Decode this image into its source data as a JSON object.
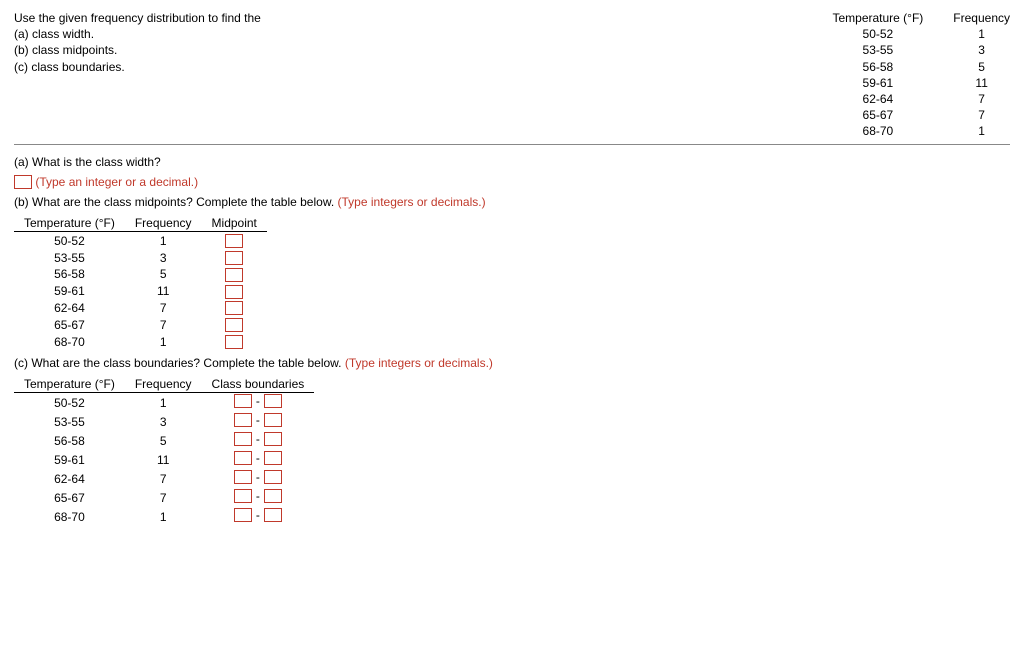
{
  "prompt": {
    "intro": "Use the given frequency distribution to find the",
    "a": "(a) class width.",
    "b": "(b) class midpoints.",
    "c": "(c) class boundaries."
  },
  "refTable": {
    "headerTemp": "Temperature (°F)",
    "headerFreq": "Frequency",
    "rows": [
      {
        "temp": "50-52",
        "freq": "1"
      },
      {
        "temp": "53-55",
        "freq": "3"
      },
      {
        "temp": "56-58",
        "freq": "5"
      },
      {
        "temp": "59-61",
        "freq": "11"
      },
      {
        "temp": "62-64",
        "freq": "7"
      },
      {
        "temp": "65-67",
        "freq": "7"
      },
      {
        "temp": "68-70",
        "freq": "1"
      }
    ]
  },
  "qA": {
    "question": "(a) What is the class width?",
    "instr": "(Type an integer or a decimal.)"
  },
  "qB": {
    "question": "(b) What are the class midpoints? Complete the table below.",
    "instr": "(Type integers or decimals.)",
    "headers": {
      "temp": "Temperature (°F)",
      "freq": "Frequency",
      "mid": "Midpoint"
    }
  },
  "qC": {
    "question": "(c) What are the class boundaries? Complete the table below.",
    "instr": "(Type integers or decimals.)",
    "headers": {
      "temp": "Temperature (°F)",
      "freq": "Frequency",
      "bnd": "Class boundaries"
    },
    "dash": "-"
  }
}
